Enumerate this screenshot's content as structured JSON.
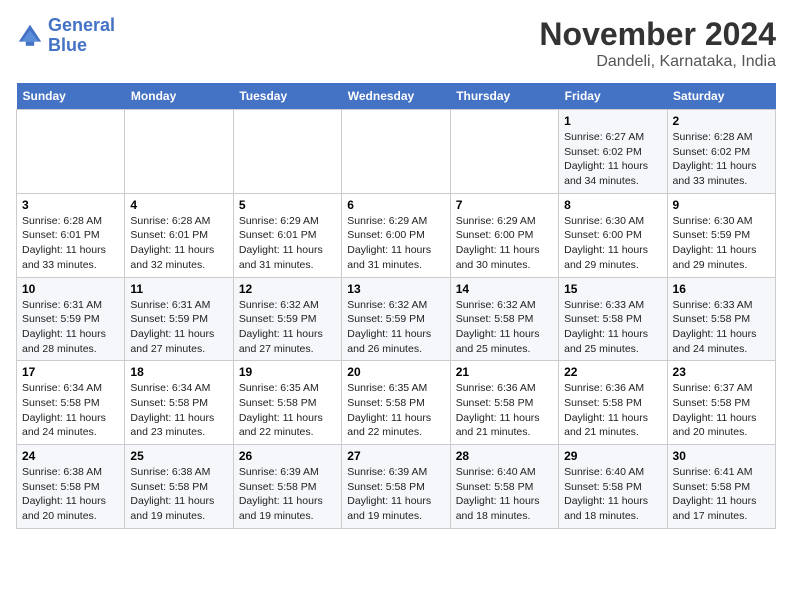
{
  "logo": {
    "line1": "General",
    "line2": "Blue"
  },
  "title": "November 2024",
  "subtitle": "Dandeli, Karnataka, India",
  "days_of_week": [
    "Sunday",
    "Monday",
    "Tuesday",
    "Wednesday",
    "Thursday",
    "Friday",
    "Saturday"
  ],
  "weeks": [
    [
      {
        "num": "",
        "info": ""
      },
      {
        "num": "",
        "info": ""
      },
      {
        "num": "",
        "info": ""
      },
      {
        "num": "",
        "info": ""
      },
      {
        "num": "",
        "info": ""
      },
      {
        "num": "1",
        "info": "Sunrise: 6:27 AM\nSunset: 6:02 PM\nDaylight: 11 hours and 34 minutes."
      },
      {
        "num": "2",
        "info": "Sunrise: 6:28 AM\nSunset: 6:02 PM\nDaylight: 11 hours and 33 minutes."
      }
    ],
    [
      {
        "num": "3",
        "info": "Sunrise: 6:28 AM\nSunset: 6:01 PM\nDaylight: 11 hours and 33 minutes."
      },
      {
        "num": "4",
        "info": "Sunrise: 6:28 AM\nSunset: 6:01 PM\nDaylight: 11 hours and 32 minutes."
      },
      {
        "num": "5",
        "info": "Sunrise: 6:29 AM\nSunset: 6:01 PM\nDaylight: 11 hours and 31 minutes."
      },
      {
        "num": "6",
        "info": "Sunrise: 6:29 AM\nSunset: 6:00 PM\nDaylight: 11 hours and 31 minutes."
      },
      {
        "num": "7",
        "info": "Sunrise: 6:29 AM\nSunset: 6:00 PM\nDaylight: 11 hours and 30 minutes."
      },
      {
        "num": "8",
        "info": "Sunrise: 6:30 AM\nSunset: 6:00 PM\nDaylight: 11 hours and 29 minutes."
      },
      {
        "num": "9",
        "info": "Sunrise: 6:30 AM\nSunset: 5:59 PM\nDaylight: 11 hours and 29 minutes."
      }
    ],
    [
      {
        "num": "10",
        "info": "Sunrise: 6:31 AM\nSunset: 5:59 PM\nDaylight: 11 hours and 28 minutes."
      },
      {
        "num": "11",
        "info": "Sunrise: 6:31 AM\nSunset: 5:59 PM\nDaylight: 11 hours and 27 minutes."
      },
      {
        "num": "12",
        "info": "Sunrise: 6:32 AM\nSunset: 5:59 PM\nDaylight: 11 hours and 27 minutes."
      },
      {
        "num": "13",
        "info": "Sunrise: 6:32 AM\nSunset: 5:59 PM\nDaylight: 11 hours and 26 minutes."
      },
      {
        "num": "14",
        "info": "Sunrise: 6:32 AM\nSunset: 5:58 PM\nDaylight: 11 hours and 25 minutes."
      },
      {
        "num": "15",
        "info": "Sunrise: 6:33 AM\nSunset: 5:58 PM\nDaylight: 11 hours and 25 minutes."
      },
      {
        "num": "16",
        "info": "Sunrise: 6:33 AM\nSunset: 5:58 PM\nDaylight: 11 hours and 24 minutes."
      }
    ],
    [
      {
        "num": "17",
        "info": "Sunrise: 6:34 AM\nSunset: 5:58 PM\nDaylight: 11 hours and 24 minutes."
      },
      {
        "num": "18",
        "info": "Sunrise: 6:34 AM\nSunset: 5:58 PM\nDaylight: 11 hours and 23 minutes."
      },
      {
        "num": "19",
        "info": "Sunrise: 6:35 AM\nSunset: 5:58 PM\nDaylight: 11 hours and 22 minutes."
      },
      {
        "num": "20",
        "info": "Sunrise: 6:35 AM\nSunset: 5:58 PM\nDaylight: 11 hours and 22 minutes."
      },
      {
        "num": "21",
        "info": "Sunrise: 6:36 AM\nSunset: 5:58 PM\nDaylight: 11 hours and 21 minutes."
      },
      {
        "num": "22",
        "info": "Sunrise: 6:36 AM\nSunset: 5:58 PM\nDaylight: 11 hours and 21 minutes."
      },
      {
        "num": "23",
        "info": "Sunrise: 6:37 AM\nSunset: 5:58 PM\nDaylight: 11 hours and 20 minutes."
      }
    ],
    [
      {
        "num": "24",
        "info": "Sunrise: 6:38 AM\nSunset: 5:58 PM\nDaylight: 11 hours and 20 minutes."
      },
      {
        "num": "25",
        "info": "Sunrise: 6:38 AM\nSunset: 5:58 PM\nDaylight: 11 hours and 19 minutes."
      },
      {
        "num": "26",
        "info": "Sunrise: 6:39 AM\nSunset: 5:58 PM\nDaylight: 11 hours and 19 minutes."
      },
      {
        "num": "27",
        "info": "Sunrise: 6:39 AM\nSunset: 5:58 PM\nDaylight: 11 hours and 19 minutes."
      },
      {
        "num": "28",
        "info": "Sunrise: 6:40 AM\nSunset: 5:58 PM\nDaylight: 11 hours and 18 minutes."
      },
      {
        "num": "29",
        "info": "Sunrise: 6:40 AM\nSunset: 5:58 PM\nDaylight: 11 hours and 18 minutes."
      },
      {
        "num": "30",
        "info": "Sunrise: 6:41 AM\nSunset: 5:58 PM\nDaylight: 11 hours and 17 minutes."
      }
    ]
  ]
}
